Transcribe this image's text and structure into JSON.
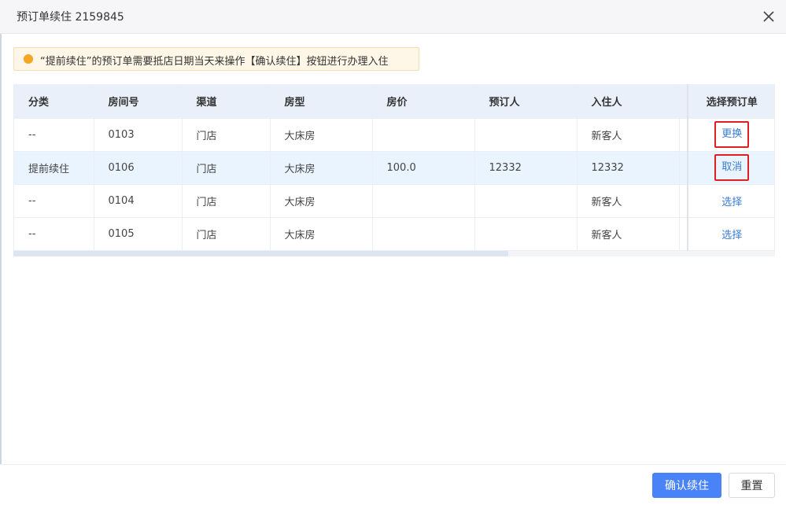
{
  "dialog": {
    "title": "预订单续住 2159845"
  },
  "notice": {
    "text": "“提前续住”的预订单需要抵店日期当天来操作【确认续住】按钮进行办理入住",
    "color": "#f5a623"
  },
  "table": {
    "columns": [
      "分类",
      "房间号",
      "渠道",
      "房型",
      "房价",
      "预订人",
      "入住人",
      "",
      "选择预订单"
    ],
    "rows": [
      {
        "category": "--",
        "room": "0103",
        "channel": "门店",
        "room_type": "大床房",
        "price": "",
        "booker": "",
        "guest": "新客人",
        "action": "更换"
      },
      {
        "category": "提前续住",
        "room": "0106",
        "channel": "门店",
        "room_type": "大床房",
        "price": "100.0",
        "booker": "12332",
        "guest": "12332",
        "action": "取消"
      },
      {
        "category": "--",
        "room": "0104",
        "channel": "门店",
        "room_type": "大床房",
        "price": "",
        "booker": "",
        "guest": "新客人",
        "action": "选择"
      },
      {
        "category": "--",
        "room": "0105",
        "channel": "门店",
        "room_type": "大床房",
        "price": "",
        "booker": "",
        "guest": "新客人",
        "action": "选择"
      }
    ]
  },
  "footer": {
    "confirm_label": "确认续住",
    "reset_label": "重置"
  },
  "colors": {
    "primary": "#4a82f7",
    "link": "#3a7bd5",
    "header_bg": "#eaf0fa",
    "highlight_row": "#eaf4ff",
    "annotation_red": "#e02020"
  }
}
